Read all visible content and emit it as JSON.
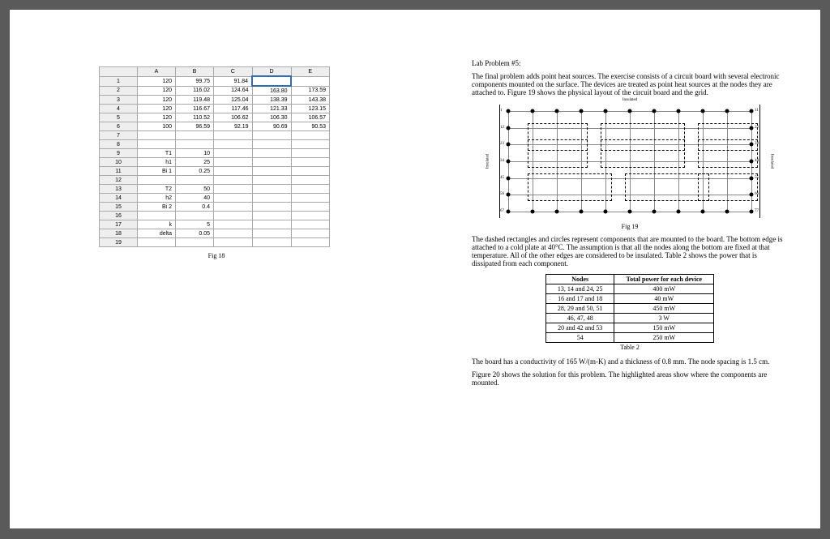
{
  "spreadsheet": {
    "cols": [
      "",
      "A",
      "B",
      "C",
      "D",
      "E"
    ],
    "rows": [
      [
        "1",
        "120",
        "99.75",
        "91.84",
        "",
        ""
      ],
      [
        "2",
        "120",
        "116.02",
        "124.64",
        "163.80",
        "173.59"
      ],
      [
        "3",
        "120",
        "119.48",
        "125.04",
        "138.39",
        "143.38"
      ],
      [
        "4",
        "120",
        "116.67",
        "117.46",
        "121.33",
        "123.15"
      ],
      [
        "5",
        "120",
        "110.52",
        "106.62",
        "106.30",
        "106.57"
      ],
      [
        "6",
        "100",
        "96.59",
        "92.19",
        "90.69",
        "90.53"
      ],
      [
        "7",
        "",
        "",
        "",
        "",
        ""
      ],
      [
        "8",
        "",
        "",
        "",
        "",
        ""
      ],
      [
        "9",
        "T1",
        "10",
        "",
        "",
        ""
      ],
      [
        "10",
        "h1",
        "25",
        "",
        "",
        ""
      ],
      [
        "11",
        "Bi 1",
        "0.25",
        "",
        "",
        ""
      ],
      [
        "12",
        "",
        "",
        "",
        "",
        ""
      ],
      [
        "13",
        "T2",
        "50",
        "",
        "",
        ""
      ],
      [
        "14",
        "h2",
        "40",
        "",
        "",
        ""
      ],
      [
        "15",
        "Bi 2",
        "0.4",
        "",
        "",
        ""
      ],
      [
        "16",
        "",
        "",
        "",
        "",
        ""
      ],
      [
        "17",
        "k",
        "5",
        "",
        "",
        ""
      ],
      [
        "18",
        "delta",
        "0.05",
        "",
        "",
        ""
      ],
      [
        "19",
        "",
        "",
        "",
        "",
        ""
      ]
    ],
    "caption": "Fig 18",
    "selected": {
      "r": 0,
      "c": 3
    }
  },
  "rhs": {
    "title": "Lab Problem #5:",
    "p1": "The final problem adds point heat sources. The exercise consists of a circuit board with several electronic components mounted on the surface. The devices are treated as point heat sources at the nodes they are attached to. Figure 19 shows the physical layout of the circuit board and the grid.",
    "fig19": "Fig 19",
    "insul": "Insulated",
    "p2": "The dashed rectangles and circles represent components that are mounted to the board. The bottom edge is attached to a cold plate at 40°C. The assumption is that all the nodes along the bottom are fixed at that temperature. All of the other edges are considered to be insulated. Table 2 shows the power that is dissipated from each component.",
    "table": {
      "head": [
        "Nodes",
        "Total power for each device"
      ],
      "rows": [
        [
          "13, 14 and 24, 25",
          "400 mW"
        ],
        [
          "16 and 17 and 18",
          "40 mW"
        ],
        [
          "28, 29 and 50, 51",
          "450 mW"
        ],
        [
          "46, 47, 48",
          "3 W"
        ],
        [
          "20 and 42 and 53",
          "150 mW"
        ],
        [
          "54",
          "250 mW"
        ]
      ],
      "caption": "Table 2"
    },
    "p3": "The board has a conductivity of 165 W/(m-K) and a thickness of 0.8 mm. The node spacing is 1.5 cm.",
    "p4": "Figure 20 shows the solution for this problem. The highlighted areas show where the components are mounted."
  }
}
